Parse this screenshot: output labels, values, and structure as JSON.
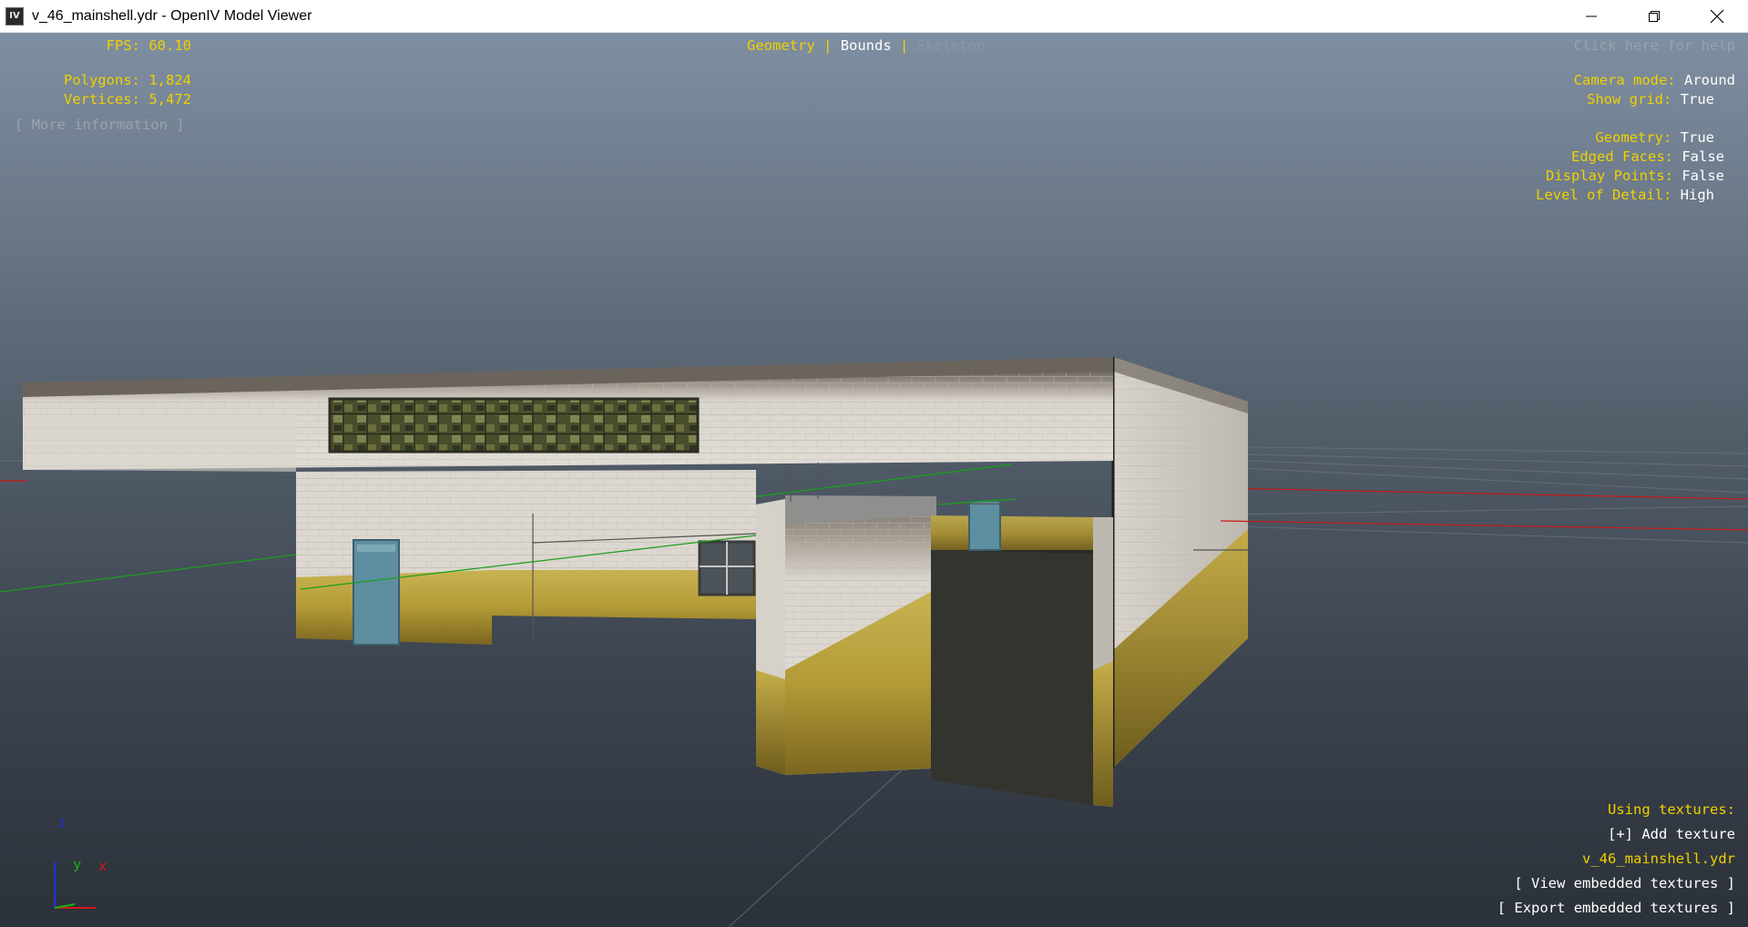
{
  "window": {
    "icon_text": "IV",
    "title": "v_46_mainshell.ydr - OpenIV Model Viewer"
  },
  "stats": {
    "fps_label": "FPS:",
    "fps_value": "60.10",
    "polygons_label": "Polygons:",
    "polygons_value": "1,824",
    "vertices_label": "Vertices:",
    "vertices_value": "5,472",
    "more_info": "[ More information ]"
  },
  "modes": {
    "geometry": "Geometry",
    "bounds": "Bounds",
    "skeleton": "Skeleton",
    "separator": "|"
  },
  "help": "Click here for help",
  "settings": [
    {
      "label": "Camera mode:",
      "value": "Around"
    },
    {
      "label": "Show grid:",
      "value": "True"
    },
    {
      "label": "Geometry:",
      "value": "True"
    },
    {
      "label": "Edged Faces:",
      "value": "False"
    },
    {
      "label": "Display Points:",
      "value": "False"
    },
    {
      "label": "Level of Detail:",
      "value": "High"
    }
  ],
  "textures": {
    "header": "Using textures:",
    "add": "[+] Add texture",
    "file": "v_46_mainshell.ydr",
    "view": "[ View embedded textures ]",
    "export": "[ Export embedded textures ]"
  },
  "axes": {
    "z": "z",
    "y": "y",
    "x": "x"
  },
  "colors": {
    "hud_label": "#f0d000",
    "hud_value": "#ffffff",
    "axis_x": "#d01818",
    "axis_y": "#18b018",
    "axis_z": "#2030e0"
  }
}
